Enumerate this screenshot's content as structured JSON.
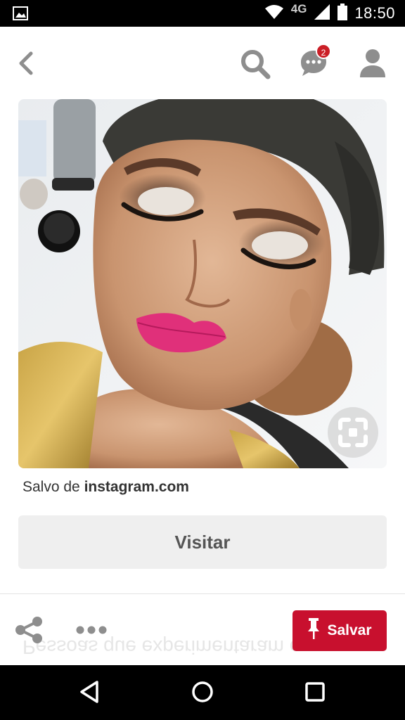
{
  "status_bar": {
    "network": "4G",
    "time": "18:50",
    "icons": [
      "image-notification-icon",
      "wifi-icon",
      "signal-icon",
      "battery-icon"
    ]
  },
  "top_bar": {
    "icons": [
      "back-icon",
      "search-icon",
      "messages-icon",
      "profile-icon"
    ],
    "message_badge": "2"
  },
  "pin": {
    "image_subject": "makeup-closeup-photo",
    "lens_icon": "visual-search-icon"
  },
  "source": {
    "prefix": "Salvo de",
    "domain": "instagram.com"
  },
  "visit_button": {
    "label": "Visitar"
  },
  "bottom_bar": {
    "share_icon": "share-icon",
    "more_icon": "more-icon",
    "save_label": "Salvar",
    "ghost_text": "Pessoas que experimentaram e"
  },
  "colors": {
    "save_red": "#c8102e",
    "badge_red": "#cb1f27",
    "icon_gray": "#8e8e8e",
    "button_gray": "#efefef"
  }
}
